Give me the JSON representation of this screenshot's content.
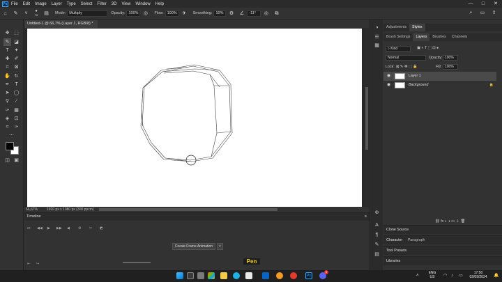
{
  "menubar": {
    "logo": "Ps",
    "items": [
      "File",
      "Edit",
      "Image",
      "Layer",
      "Type",
      "Select",
      "Filter",
      "3D",
      "View",
      "Window",
      "Help"
    ],
    "window_controls": [
      "—",
      "□",
      "✕"
    ]
  },
  "options_bar": {
    "brush_size": "70",
    "mode_label": "Mode:",
    "mode_value": "Multiply",
    "opacity_label": "Opacity:",
    "opacity_value": "100%",
    "flow_label": "Flow:",
    "flow_value": "100%",
    "smoothing_label": "Smoothing:",
    "smoothing_value": "10%",
    "angle_value": "-11°"
  },
  "document": {
    "tab_title": "Untitled-1 @ 66,7% (Layer 1, RGB/8) *",
    "zoom": "66,67%",
    "doc_info": "1920 px x 1080 px (300 ppcm)"
  },
  "timeline": {
    "title": "Timeline",
    "create_button": "Create Frame Animation"
  },
  "right_panel": {
    "top_tabs": [
      "Adjustments",
      "Styles"
    ],
    "layer_tabs": [
      "Brush Settings",
      "Layers",
      "Brushes",
      "Channels"
    ],
    "kind_label": "Kind",
    "blend_mode": "Normal",
    "opacity_label": "Opacity:",
    "opacity_value": "100%",
    "lock_label": "Lock:",
    "fill_label": "Fill:",
    "fill_value": "100%",
    "layers": [
      {
        "name": "Layer 1",
        "selected": true
      },
      {
        "name": "Background",
        "selected": false
      }
    ],
    "collapsed_panels": [
      "Clone Source",
      "Character",
      "Paragraph",
      "Tool Presets",
      "Libraries"
    ]
  },
  "caption": "Pen",
  "taskbar": {
    "lang": "ENG",
    "region": "US",
    "time": "17:50",
    "date": "02/09/2024",
    "badge": "3"
  },
  "colors": {
    "ps_blue": "#31a8ff",
    "panel_bg": "#323232",
    "caption_yellow": "#f5d020"
  }
}
